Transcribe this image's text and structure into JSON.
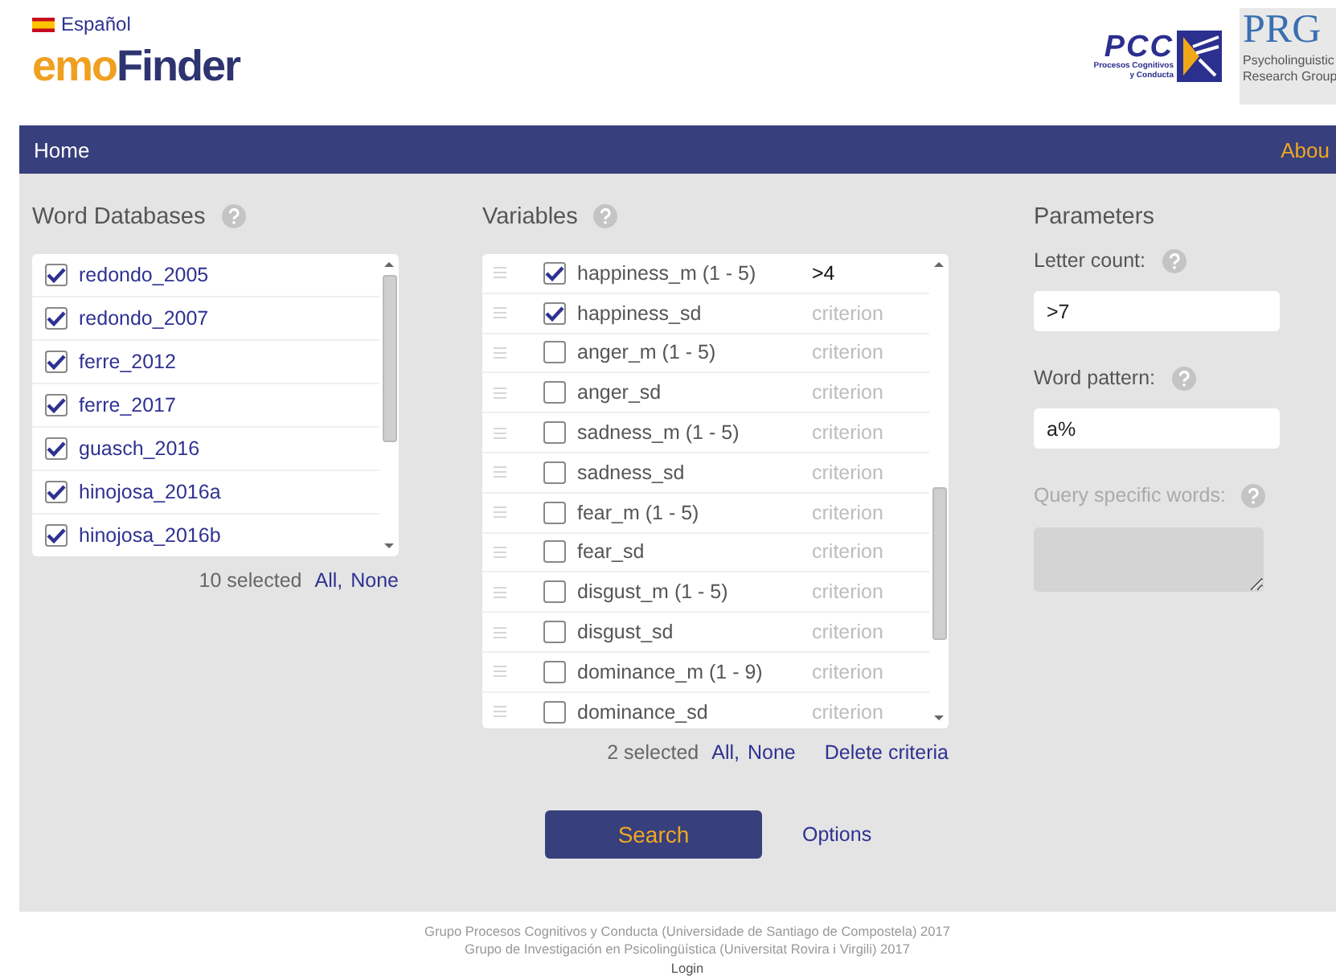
{
  "language": {
    "label": "Español"
  },
  "logo": {
    "part_1": "emo",
    "part_2": "Finder"
  },
  "partner_logos": [
    {
      "kind": "pcc",
      "title": "PCC",
      "subtitle_1": "Procesos Cognitivos",
      "subtitle_2": "y Conducta"
    },
    {
      "kind": "prg",
      "title": "PRG",
      "subtitle_1": "Psycholinguistic",
      "subtitle_2": "Research Group"
    }
  ],
  "nav": {
    "items": [
      {
        "label": "Home",
        "kind": "left"
      },
      {
        "label": "Abou",
        "kind": "right"
      }
    ]
  },
  "word_databases": {
    "title": "Word Databases",
    "items": [
      {
        "label": "redondo_2005",
        "checked": true
      },
      {
        "label": "redondo_2007",
        "checked": true
      },
      {
        "label": "ferre_2012",
        "checked": true
      },
      {
        "label": "ferre_2017",
        "checked": true
      },
      {
        "label": "guasch_2016",
        "checked": true
      },
      {
        "label": "hinojosa_2016a",
        "checked": true
      },
      {
        "label": "hinojosa_2016b",
        "checked": true
      }
    ],
    "count": "10 selected",
    "all": "All,",
    "none": "None"
  },
  "variables": {
    "title": "Variables",
    "items": [
      {
        "label": "happiness_m (1 - 5)",
        "checked": true,
        "criterion": ">4"
      },
      {
        "label": "happiness_sd",
        "checked": true,
        "placeholder": "criterion"
      },
      {
        "label": "anger_m (1 - 5)",
        "checked": false,
        "placeholder": "criterion"
      },
      {
        "label": "anger_sd",
        "checked": false,
        "placeholder": "criterion"
      },
      {
        "label": "sadness_m (1 - 5)",
        "checked": false,
        "placeholder": "criterion"
      },
      {
        "label": "sadness_sd",
        "checked": false,
        "placeholder": "criterion"
      },
      {
        "label": "fear_m (1 - 5)",
        "checked": false,
        "placeholder": "criterion"
      },
      {
        "label": "fear_sd",
        "checked": false,
        "placeholder": "criterion"
      },
      {
        "label": "disgust_m (1 - 5)",
        "checked": false,
        "placeholder": "criterion"
      },
      {
        "label": "disgust_sd",
        "checked": false,
        "placeholder": "criterion"
      },
      {
        "label": "dominance_m (1 - 9)",
        "checked": false,
        "placeholder": "criterion"
      },
      {
        "label": "dominance_sd",
        "checked": false,
        "placeholder": "criterion"
      }
    ],
    "count": "2 selected",
    "all": "All,",
    "none": "None",
    "delete": "Delete criteria"
  },
  "parameters": {
    "title": "Parameters",
    "fields": [
      {
        "label": "Letter count:",
        "value": ">7",
        "kind": "input",
        "disabled": false
      },
      {
        "label": "Word pattern:",
        "value": "a%",
        "kind": "input",
        "disabled": false
      },
      {
        "label": "Query specific words:",
        "kind": "textarea",
        "disabled": true
      }
    ]
  },
  "search_button": "Search",
  "options_link": "Options",
  "footer": {
    "lines": [
      "Grupo Procesos Cognitivos y Conducta (Universidade de Santiago de Compostela) 2017",
      "Grupo de Investigación en Psicolingüística (Universitat Rovira i Virgili) 2017"
    ],
    "login": "Login"
  }
}
